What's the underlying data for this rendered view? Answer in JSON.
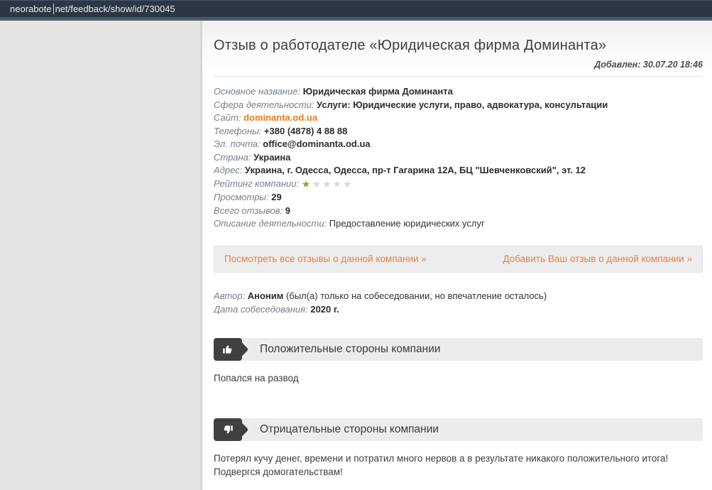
{
  "browser_bar": {
    "url_before_caret": "neorabote",
    "url_after_caret": "net/feedback/show/id/730045"
  },
  "header": {
    "title": "Отзыв о работодателе «Юридическая фирма Доминанта»",
    "added_label": "Добавлен:",
    "added_value": "30.07.20 18:46"
  },
  "company": {
    "fields": [
      {
        "label": "Основное название:",
        "value": "Юридическая фирма Доминанта"
      },
      {
        "label": "Сфера деятельности:",
        "value": "Услуги: Юридические услуги, право, адвокатура, консультации"
      },
      {
        "label": "Сайт:",
        "value": "dominanta.od.ua"
      },
      {
        "label": "Телефоны:",
        "value": "+380 (4878) 4 88 88"
      },
      {
        "label": "Эл. почта:",
        "value": "office@dominanta.od.ua"
      },
      {
        "label": "Страна:",
        "value": "Украина"
      },
      {
        "label": "Адрес:",
        "value": "Украина, г. Одесса, Одесса, пр-т Гагарина 12А, БЦ \"Шевченковский\", эт. 12"
      },
      {
        "label": "Рейтинг компании:",
        "value": ""
      },
      {
        "label": "Просмотры:",
        "value": "29"
      },
      {
        "label": "Всего отзывов:",
        "value": "9"
      },
      {
        "label": "Описание деятельности:",
        "value": "Предоставление юридических услуг"
      }
    ],
    "rating": {
      "value": 1.15,
      "max": 5,
      "filled_color": "#8ca339",
      "empty_color": "#d9d9d9"
    }
  },
  "actions": {
    "view_all_label": "Посмотреть все отзывы о данной компании »",
    "add_review_label": "Добавить Ваш отзыв о данной компании »"
  },
  "review": {
    "author_label": "Автор:",
    "author_name": "Аноним",
    "author_note": "(был(а) только на собеседовании, но впечатление осталось)",
    "interview_date_label": "Дата собеседования:",
    "interview_date_value": "2020 г.",
    "sections": [
      {
        "icon": "thumbs-up-icon",
        "title": "Положительные стороны компании",
        "text": "Попался на развод"
      },
      {
        "icon": "thumbs-down-icon",
        "title": "Отрицательные стороны компании",
        "text": "Потерял кучу денег, времени и потратил много нервов а в результате никакого положительного итога! Подвергся домогательствам!"
      }
    ]
  },
  "colors": {
    "topbar": "#2b3743",
    "accent_orange": "#ee7a18",
    "link_orange": "#e5814a",
    "star_filled": "#8ca339",
    "badge_dark": "#404040"
  }
}
